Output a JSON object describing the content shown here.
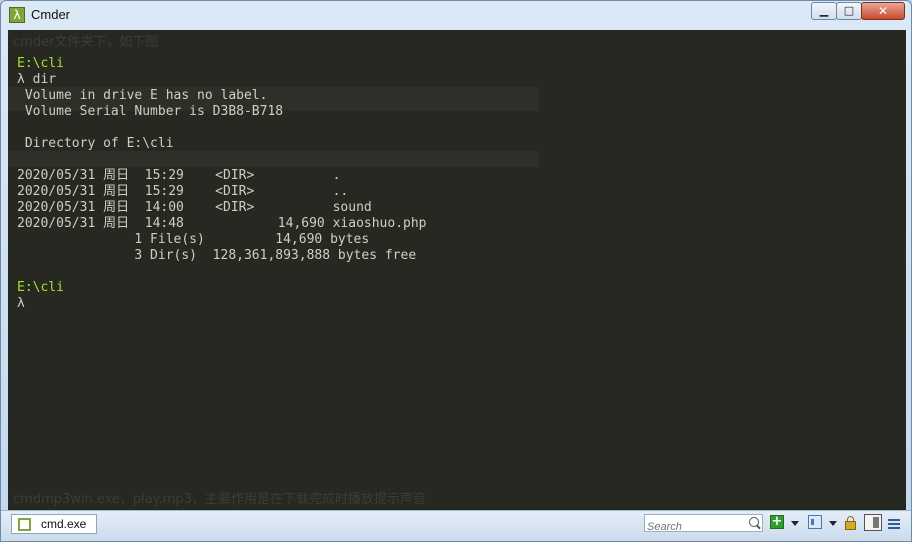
{
  "window": {
    "title": "Cmder",
    "app_icon_glyph": "λ",
    "controls": {
      "minimize_glyph": "▁",
      "maximize_glyph": "□",
      "close_glyph": "✕"
    }
  },
  "background_bleed": {
    "top_text": "cmder文件夹下，如下图",
    "bottom_text": "cmdmp3win.exe，play.mp3，主要作用是在下载完成时播放提示声音"
  },
  "terminal": {
    "lines": [
      {
        "text": "E:\\cli",
        "color": "#a6e22e"
      },
      {
        "text": "λ dir"
      },
      {
        "text": " Volume in drive E has no label."
      },
      {
        "text": " Volume Serial Number is D3B8-B718"
      },
      {
        "text": ""
      },
      {
        "text": " Directory of E:\\cli"
      },
      {
        "text": ""
      },
      {
        "text": "2020/05/31 周日  15:29    <DIR>          ."
      },
      {
        "text": "2020/05/31 周日  15:29    <DIR>          .."
      },
      {
        "text": "2020/05/31 周日  14:00    <DIR>          sound"
      },
      {
        "text": "2020/05/31 周日  14:48            14,690 xiaoshuo.php"
      },
      {
        "text": "               1 File(s)         14,690 bytes"
      },
      {
        "text": "               3 Dir(s)  128,361,893,888 bytes free"
      },
      {
        "text": ""
      },
      {
        "text": "E:\\cli",
        "color": "#a6e22e"
      },
      {
        "text": "λ"
      }
    ]
  },
  "statusbar": {
    "tab_label": "cmd.exe",
    "search_placeholder": "Search",
    "new_console_glyph": "+"
  }
}
